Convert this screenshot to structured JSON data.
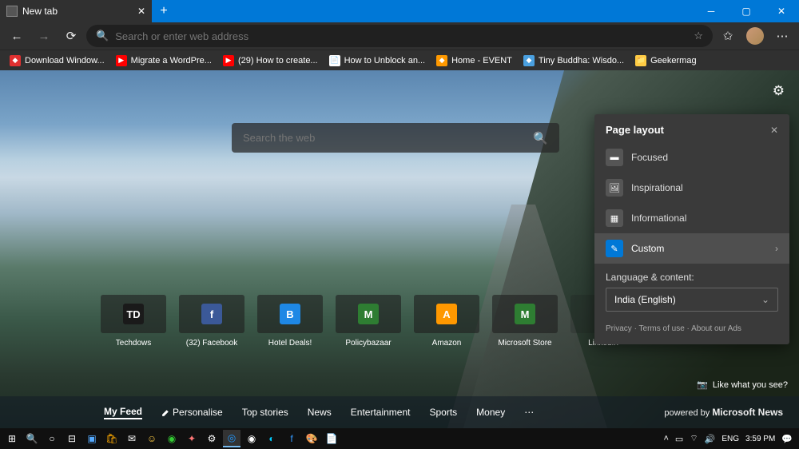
{
  "tab": {
    "title": "New tab"
  },
  "addressbar": {
    "placeholder": "Search or enter web address"
  },
  "bookmarks": [
    {
      "label": "Download Window...",
      "icon": "windows",
      "color": "#e03030"
    },
    {
      "label": "Migrate a WordPre...",
      "icon": "youtube",
      "color": "#ff0000"
    },
    {
      "label": "(29) How to create...",
      "icon": "youtube",
      "color": "#ff0000"
    },
    {
      "label": "How to Unblock an...",
      "icon": "page",
      "color": "#ffffff"
    },
    {
      "label": "Home - EVENT",
      "icon": "diamond",
      "color": "#ff9900"
    },
    {
      "label": "Tiny Buddha: Wisdo...",
      "icon": "tb",
      "color": "#4aa0e0"
    },
    {
      "label": "Geekermag",
      "icon": "folder",
      "color": "#ffcc44"
    }
  ],
  "websearch": {
    "placeholder": "Search the web"
  },
  "tiles": [
    {
      "label": "Techdows",
      "letters": "TD",
      "bg": "#1a1a1a",
      "fg": "#ffffff"
    },
    {
      "label": "(32) Facebook",
      "letters": "f",
      "bg": "#3b5998",
      "fg": "#ffffff"
    },
    {
      "label": "Hotel Deals!",
      "letters": "B",
      "bg": "#1e88e5",
      "fg": "#ffffff"
    },
    {
      "label": "Policybazaar",
      "letters": "M",
      "bg": "#2e7d32",
      "fg": "#ffffff"
    },
    {
      "label": "Amazon",
      "letters": "A",
      "bg": "#ff9800",
      "fg": "#ffffff"
    },
    {
      "label": "Microsoft Store",
      "letters": "M",
      "bg": "#2e7d32",
      "fg": "#ffffff"
    },
    {
      "label": "LinkedIn",
      "letters": "",
      "bg": "",
      "fg": ""
    }
  ],
  "like_prompt": "Like what you see?",
  "feed": {
    "items": [
      "My Feed",
      "Personalise",
      "Top stories",
      "News",
      "Entertainment",
      "Sports",
      "Money"
    ],
    "powered_prefix": "powered by ",
    "powered_name": "Microsoft News"
  },
  "panel": {
    "title": "Page layout",
    "options": [
      "Focused",
      "Inspirational",
      "Informational",
      "Custom"
    ],
    "lang_label": "Language & content:",
    "lang_value": "India (English)",
    "links": {
      "privacy": "Privacy",
      "terms": "Terms of use",
      "ads": "About our Ads"
    }
  },
  "tray": {
    "lang": "ENG",
    "time": "3:59 PM"
  }
}
